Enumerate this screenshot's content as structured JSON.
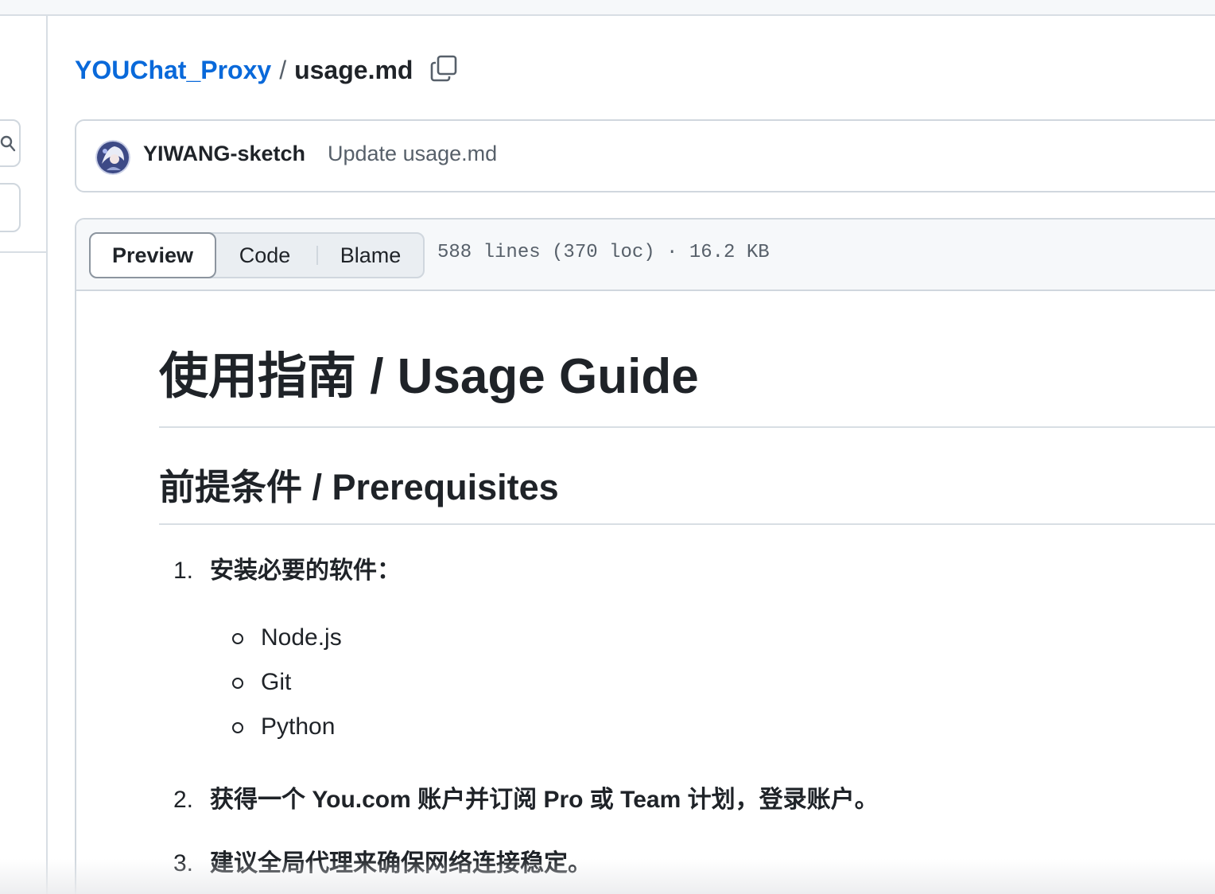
{
  "breadcrumb": {
    "repo": "YOUChat_Proxy",
    "separator": "/",
    "file": "usage.md"
  },
  "commit": {
    "author": "YIWANG-sketch",
    "message": "Update usage.md"
  },
  "view_tabs": {
    "preview": "Preview",
    "code": "Code",
    "blame": "Blame",
    "selected": "Preview"
  },
  "file_meta": "588 lines (370 loc) · 16.2 KB",
  "content": {
    "h1": "使用指南 / Usage Guide",
    "h2": "前提条件 / Prerequisites",
    "list": [
      {
        "num": "1.",
        "text": "安装必要的软件：",
        "sub": [
          "Node.js",
          "Git",
          "Python"
        ]
      },
      {
        "num": "2.",
        "text": "获得一个 You.com 账户并订阅 Pro 或 Team 计划，登录账户。"
      },
      {
        "num": "3.",
        "text": "建议全局代理来确保网络连接稳定。"
      }
    ]
  },
  "icons": {
    "copy": "copy-icon",
    "search": "search-icon",
    "avatar": "avatar"
  },
  "colors": {
    "link": "#0969da",
    "text": "#1f2328",
    "muted": "#57606a",
    "border": "#d0d7de"
  }
}
